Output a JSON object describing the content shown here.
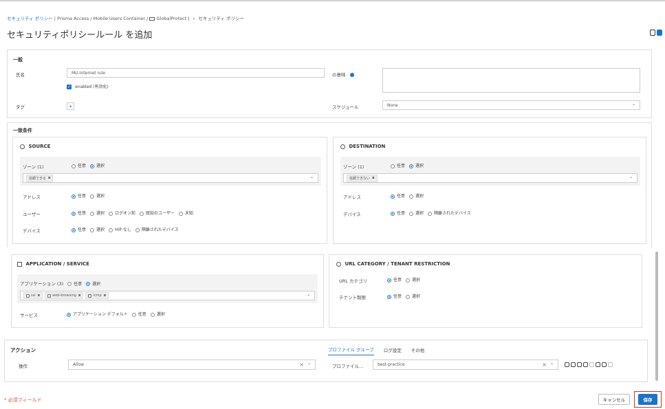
{
  "breadcrumb": {
    "link": "セキュリティ ポリシー",
    "path": "| Prisma Access / Mobile Users Container /",
    "folder": "GlobalProtect",
    "sep": "|",
    "arrow": "›",
    "current": "セキュリティ ポリシー"
  },
  "page_title": "セキュリティポリシールール を追加",
  "general": {
    "heading": "一般",
    "name_label": "氏名",
    "name_value": "MU-Internet rule",
    "enabled_label": "enabled (有効化)",
    "description_label": "の意味",
    "tag_label": "タグ",
    "tag_add": "+",
    "schedule_label": "スケジュール",
    "schedule_value": "None"
  },
  "match": {
    "heading": "一致条件",
    "source": {
      "title": "SOURCE",
      "zone_label": "ゾーン (1)",
      "zone_opts": [
        "任意",
        "選択"
      ],
      "zone_chip": "信頼できる",
      "address_label": "アドレス",
      "address_opts": [
        "任意",
        "選択"
      ],
      "user_label": "ユーザー",
      "user_opts": [
        "任意",
        "選択",
        "ログオン前",
        "既知のユーザー",
        "未知"
      ],
      "device_label": "デバイス",
      "device_opts": [
        "任意",
        "選択",
        "HIP なし",
        "隔離されたデバイス"
      ]
    },
    "destination": {
      "title": "DESTINATION",
      "zone_label": "ゾーン (1)",
      "zone_opts": [
        "任意",
        "選択"
      ],
      "zone_chip": "信頼できない",
      "address_label": "アドレス",
      "address_opts": [
        "任意",
        "選択"
      ],
      "device_label": "デバイス",
      "device_opts": [
        "任意",
        "選択",
        "隔離されたデバイス"
      ]
    },
    "app": {
      "title": "APPLICATION / SERVICE",
      "app_label": "アプリケーション (3)",
      "app_opts": [
        "任意",
        "選択"
      ],
      "chips": [
        "ssl",
        "web-browsing",
        "icmp"
      ],
      "service_label": "サービス",
      "service_opts": [
        "アプリケーション デフォルト",
        "任意",
        "選択"
      ]
    },
    "url": {
      "title": "URL CATEGORY / TENANT RESTRICTION",
      "url_label": "URL カテゴリ",
      "url_opts": [
        "任意",
        "選択"
      ],
      "tenant_label": "テナント制限",
      "tenant_opts": [
        "任意",
        "選択"
      ]
    }
  },
  "action": {
    "heading": "アクション",
    "op_label": "操作",
    "op_value": "Allow",
    "tabs": [
      "プロファイル グループ",
      "ログ設定",
      "その他"
    ],
    "profile_label": "プロファイル...",
    "profile_value": "best-practice",
    "clear_icon": "×",
    "caret": "⌄"
  },
  "footer": {
    "required": "* 必須フィールド",
    "cancel": "キャンセル",
    "save": "保存"
  },
  "colors": {
    "accent": "#1a73c9",
    "required": "#d9534f",
    "save_outline": "#c0392b"
  }
}
